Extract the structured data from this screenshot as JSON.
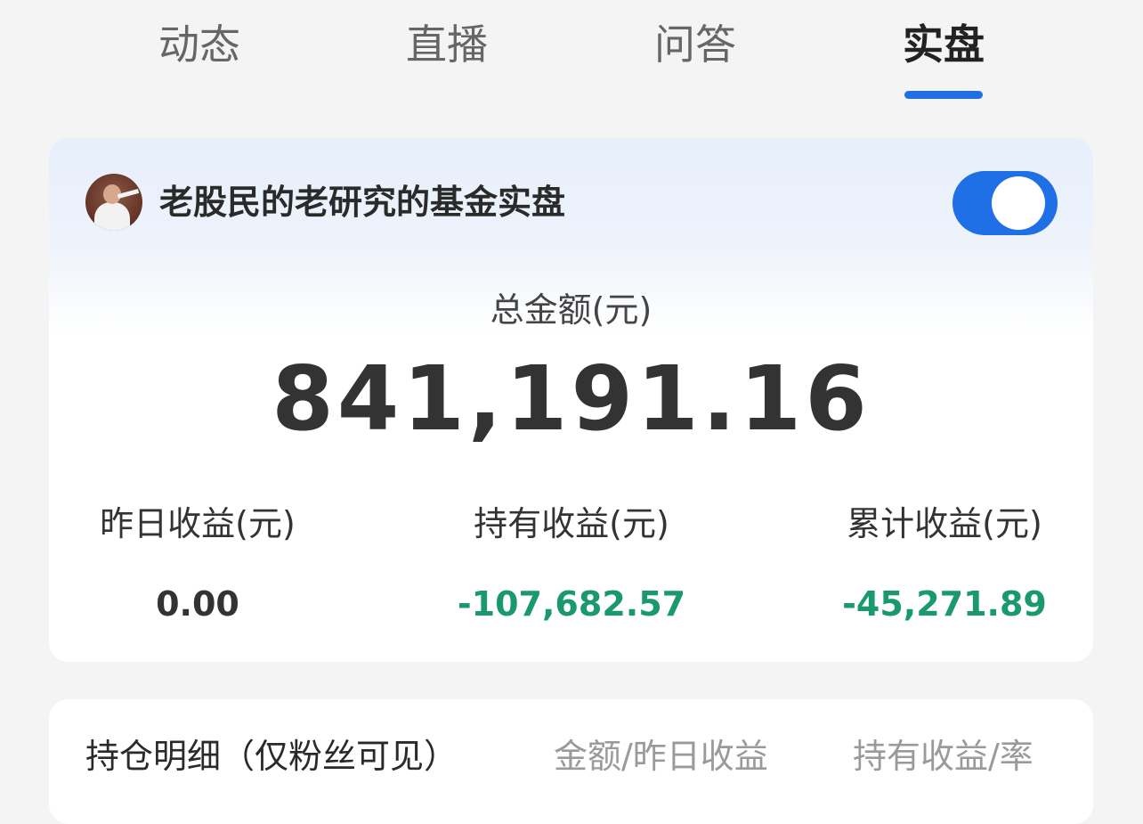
{
  "tabs": [
    {
      "label": "动态"
    },
    {
      "label": "直播"
    },
    {
      "label": "问答"
    },
    {
      "label": "实盘"
    }
  ],
  "active_tab": "实盘",
  "summary": {
    "fund_title": "老股民的老研究的基金实盘",
    "toggle_on": true,
    "total_label": "总金额(元)",
    "total_value": "841,191.16",
    "stats": [
      {
        "label": "昨日收益(元)",
        "value": "0.00",
        "color": "#333333"
      },
      {
        "label": "持有收益(元)",
        "value": "-107,682.57",
        "color": "#1a9a6c"
      },
      {
        "label": "累计收益(元)",
        "value": "-45,271.89",
        "color": "#1a9a6c"
      }
    ]
  },
  "holdings": {
    "title": "持仓明细（仅粉丝可见）",
    "col_amount": "金额/昨日收益",
    "col_profit": "持有收益/率"
  },
  "colors": {
    "accent": "#1f6fe6",
    "negative": "#1a9a6c",
    "background": "#f4f4f5"
  }
}
